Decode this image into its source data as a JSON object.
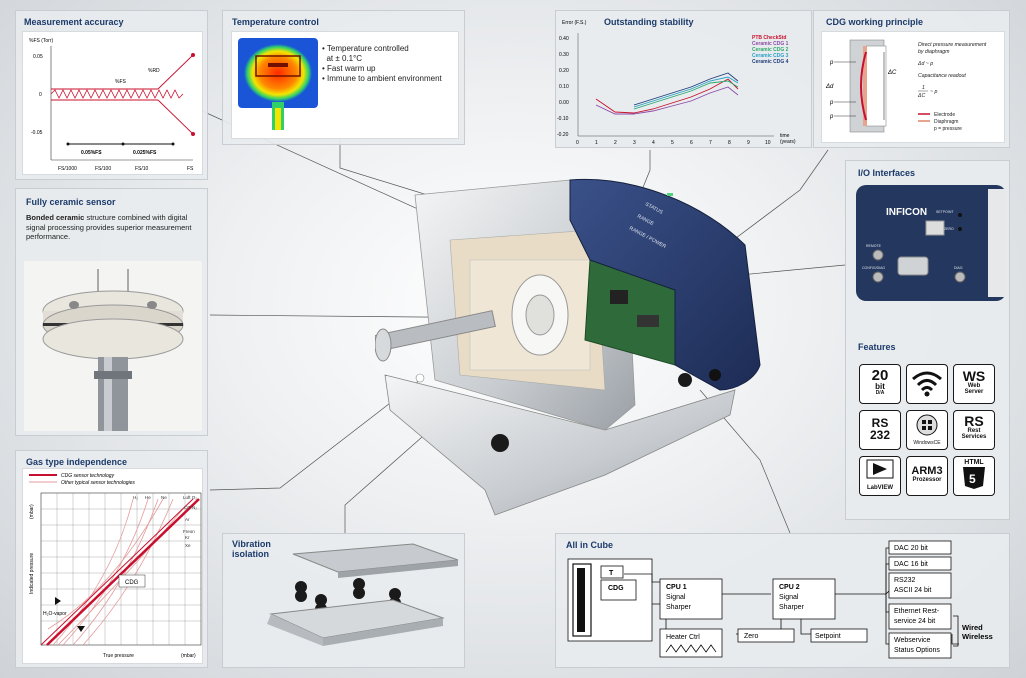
{
  "panels": {
    "accuracy": {
      "title": "Measurement accuracy",
      "ylabel": "%FS (Torr)",
      "yticks": [
        "0.05",
        "0",
        "-0.05"
      ],
      "xticks": [
        "FS/1000",
        "FS/100",
        "FS/10",
        "FS"
      ],
      "label_fs": "%FS",
      "label_rd": "%RD",
      "acc1": "0.05%FS",
      "acc2": "0.025%FS"
    },
    "temperature": {
      "title": "Temperature control",
      "bullets": [
        "Temperature controlled",
        "at ± 0.1°C",
        "Fast warm up",
        "Immune to ambient environment"
      ]
    },
    "stability": {
      "title": "Outstanding stability",
      "ylabel": "Error (F.S.)",
      "xlabel": "time",
      "xunit": "(years)",
      "yticks": [
        "0.40",
        "0.30",
        "0.20",
        "0.10",
        "0.00",
        "-0.10",
        "-0.20"
      ],
      "xticks": [
        "0",
        "1",
        "2",
        "3",
        "4",
        "5",
        "6",
        "7",
        "8",
        "9",
        "10"
      ],
      "legend": [
        "PTB CheckStd",
        "Ceramic CDG 1",
        "Ceramic CDG 2",
        "Ceramic CDG 3",
        "Ceramic CDG 4"
      ]
    },
    "cdg": {
      "title": "CDG working principle",
      "text1": "Direct pressure measurement",
      "text2": "by diaphragm",
      "eq1": "Δd ~ p",
      "text3": "Capacitance readout",
      "eq2": "1",
      "eq3": "ΔC",
      "eq4": "~ p",
      "legend": [
        "Electrode",
        "Diaphragm",
        "p = pressure"
      ],
      "labels": [
        "p",
        "Δd",
        "p",
        "p",
        "ΔC"
      ]
    },
    "ceramic": {
      "title": "Fully ceramic sensor",
      "bold": "Bonded ceramic",
      "text": " structure combined with digital signal processing provides superior measurement performance."
    },
    "gas": {
      "title": "Gas type independence",
      "legend": [
        "CDG sensor technology",
        "Other typical sensor technologies"
      ],
      "ylabel": "Indicated pressure",
      "yunit": "(mbar)",
      "xlabel": "True pressure",
      "xunit": "(mbar)",
      "gases": [
        "H₂",
        "He",
        "Ne",
        "Luft O₂",
        "CO N₂",
        "Ar",
        "Freon",
        "Kr",
        "Xe"
      ],
      "cdg_label": "CDG",
      "vapor_label": "H₂O-vapor"
    },
    "vibration": {
      "title": "Vibration isolation"
    },
    "io": {
      "title": "I/O Interfaces",
      "brand": "INFICON",
      "port_labels": [
        "SETPOINT",
        "ZERO",
        "REMOTE",
        "CONFIG/DIAG",
        "DIAG"
      ]
    },
    "features": {
      "title": "Features",
      "tiles": [
        {
          "big": "20",
          "sub": "bit",
          "sub2": "D/A"
        },
        {
          "big": "",
          "sub": "",
          "sub2": ""
        },
        {
          "big": "WS",
          "sub": "Web",
          "sub2": "Server"
        },
        {
          "big": "RS",
          "sub": "232",
          "sub2": ""
        },
        {
          "big": "",
          "sub": "WindowsCE",
          "sub2": ""
        },
        {
          "big": "RS",
          "sub": "Rest",
          "sub2": "Services"
        },
        {
          "big": "",
          "sub": "LabVIEW",
          "sub2": ""
        },
        {
          "big": "ARM3",
          "sub": "Prozessor",
          "sub2": ""
        },
        {
          "big": "HTML",
          "sub": "5",
          "sub2": ""
        }
      ]
    },
    "cube": {
      "title": "All in Cube",
      "t": "T",
      "cdg": "CDG",
      "cpu1": [
        "CPU 1",
        "Signal",
        "Sharper"
      ],
      "cpu2": [
        "CPU 2",
        "Signal",
        "Sharper"
      ],
      "heater": "Heater Ctrl",
      "zero": "Zero",
      "setpoint": "Setpoint",
      "outputs": [
        "DAC 20 bit",
        "DAC 16 bit",
        "RS232",
        "ASCII 24 bit",
        "Ethernet Rest-",
        "service 24 bit",
        "Webservice",
        "Status Options"
      ],
      "wired": [
        "Wired",
        "Wireless"
      ]
    }
  },
  "device": {
    "panel_text": [
      "STATUS",
      "RANGE",
      "RANGE / POWER"
    ]
  },
  "colors": {
    "title_blue": "#1b3a6b",
    "red": "#c8102e",
    "device_blue": "#2b3e6b"
  }
}
